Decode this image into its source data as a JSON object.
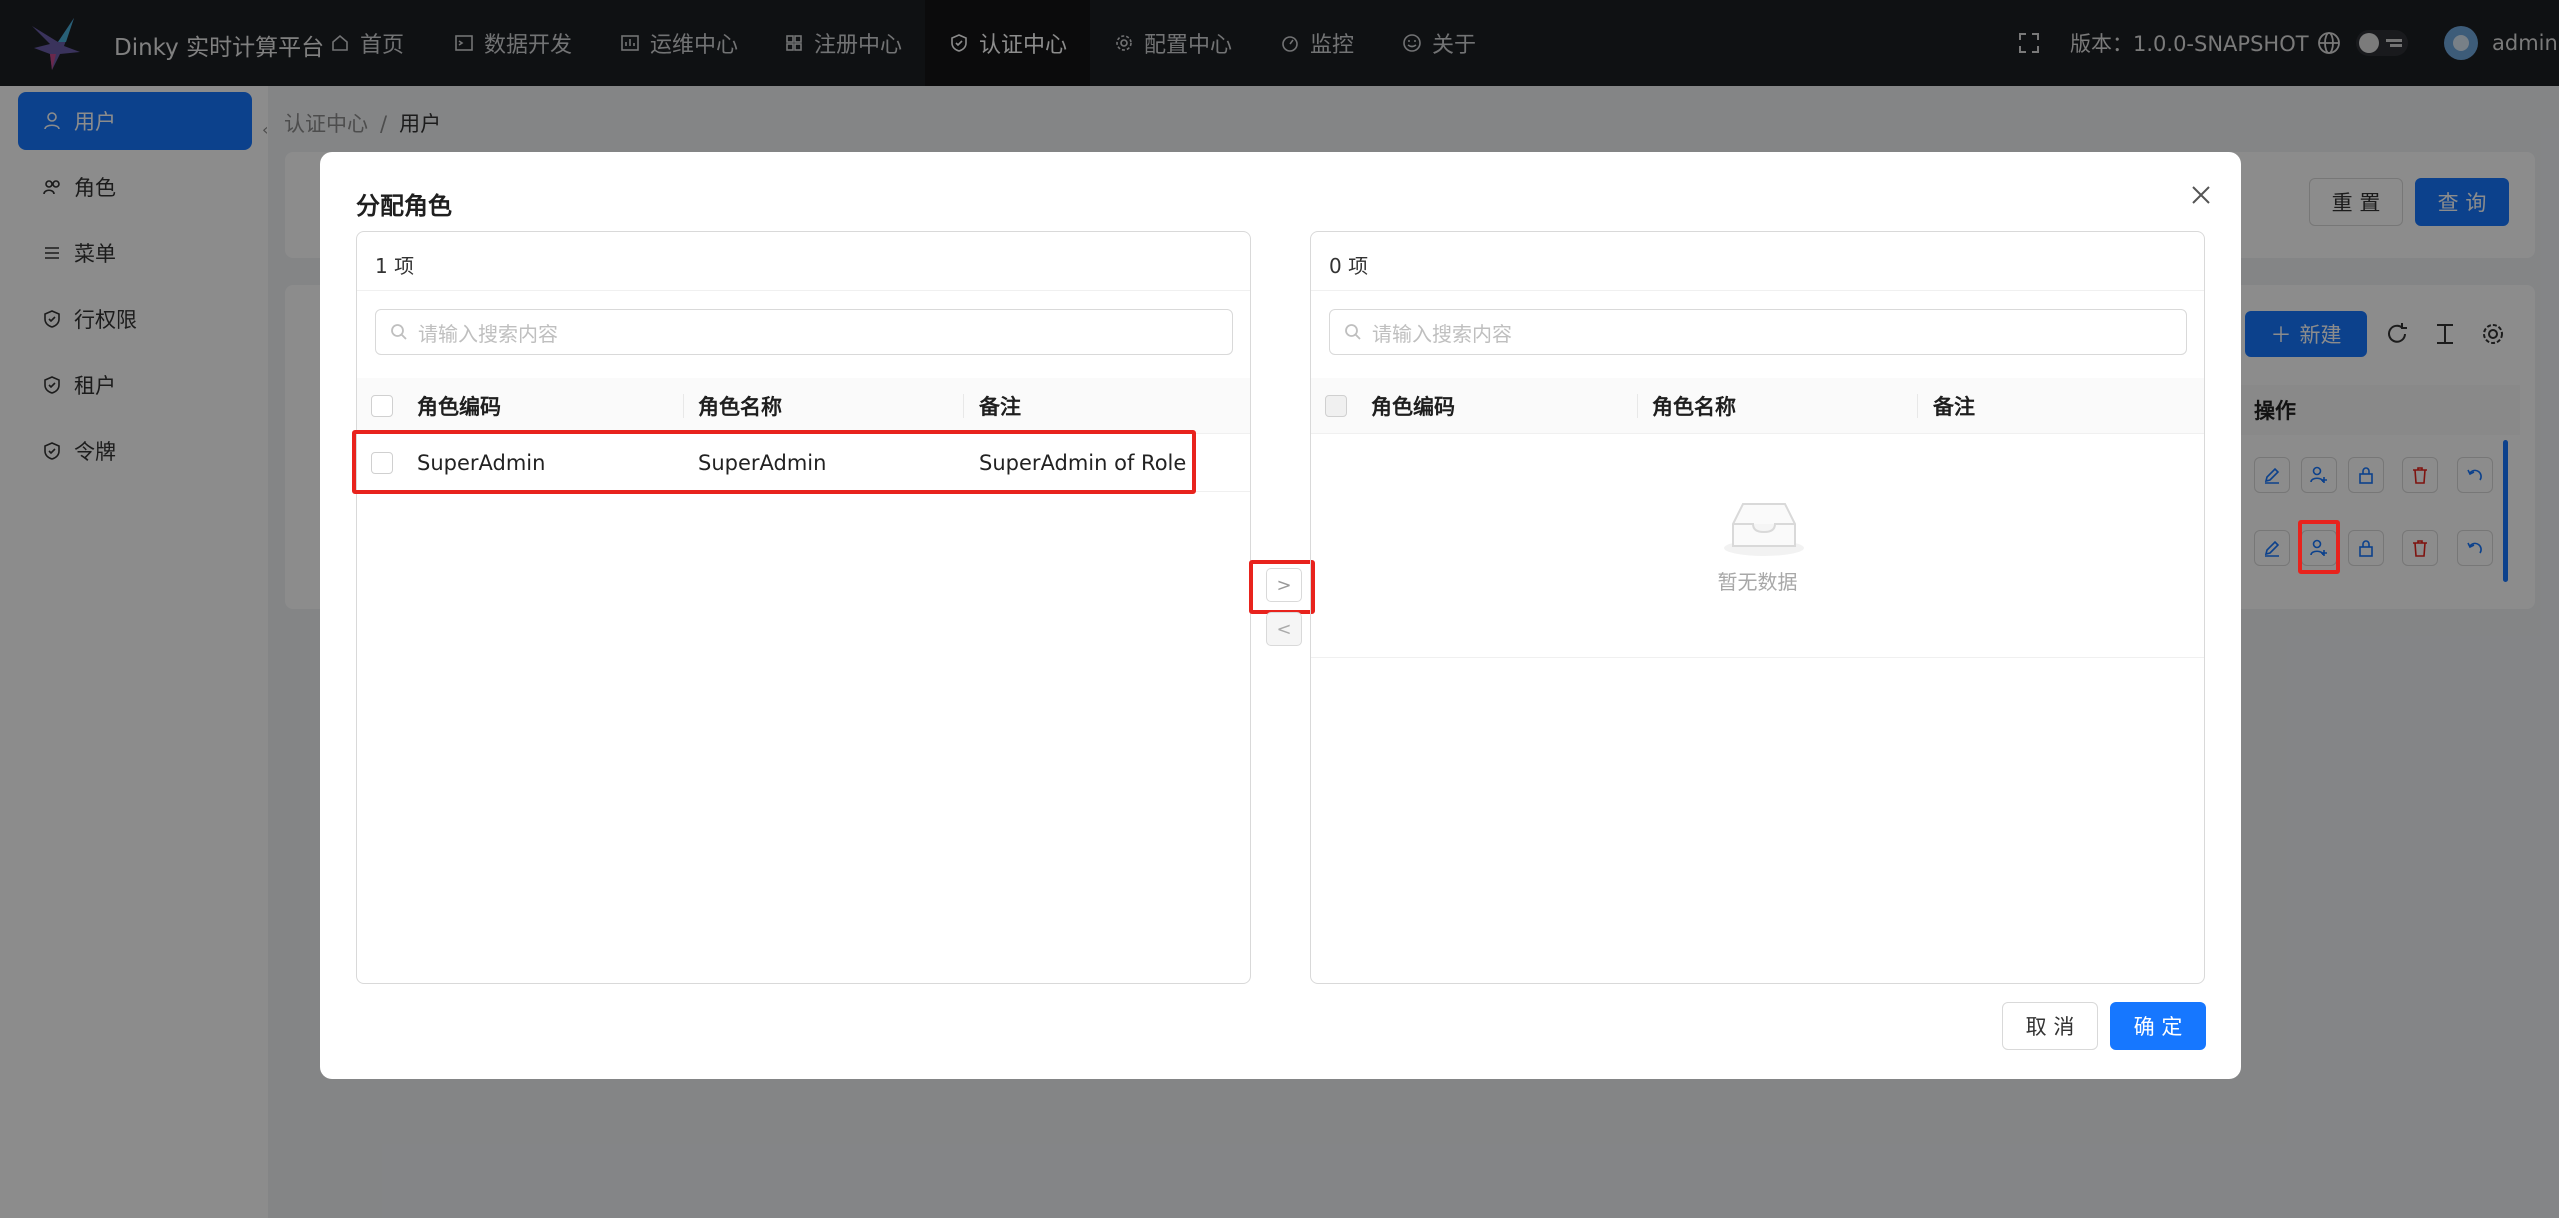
{
  "app": {
    "title": "Dinky 实时计算平台",
    "version_label": "版本：1.0.0-SNAPSHOT",
    "user": "admin"
  },
  "nav": [
    {
      "label": "首页",
      "icon": "home-icon"
    },
    {
      "label": "数据开发",
      "icon": "terminal-icon"
    },
    {
      "label": "运维中心",
      "icon": "chart-icon"
    },
    {
      "label": "注册中心",
      "icon": "grid-icon"
    },
    {
      "label": "认证中心",
      "icon": "shield-icon",
      "active": true
    },
    {
      "label": "配置中心",
      "icon": "gear-icon"
    },
    {
      "label": "监控",
      "icon": "dashboard-icon"
    },
    {
      "label": "关于",
      "icon": "smile-icon"
    }
  ],
  "sidebar": {
    "items": [
      {
        "label": "用户",
        "icon": "user-icon",
        "active": true
      },
      {
        "label": "角色",
        "icon": "team-icon"
      },
      {
        "label": "菜单",
        "icon": "menu-icon"
      },
      {
        "label": "行权限",
        "icon": "shield-icon"
      },
      {
        "label": "租户",
        "icon": "shield-icon"
      },
      {
        "label": "令牌",
        "icon": "shield-icon"
      }
    ]
  },
  "breadcrumb": {
    "parent": "认证中心",
    "sep": "/",
    "current": "用户"
  },
  "background": {
    "reset_label": "重 置",
    "query_label": "查 询",
    "new_label": "新建",
    "ops_header": "操作"
  },
  "modal": {
    "title": "分配角色",
    "left": {
      "count": "1 项",
      "search_placeholder": "请输入搜索内容",
      "columns": [
        "角色编码",
        "角色名称",
        "备注"
      ],
      "rows": [
        {
          "code": "SuperAdmin",
          "name": "SuperAdmin",
          "remark": "SuperAdmin of Role"
        }
      ]
    },
    "right": {
      "count": "0 项",
      "search_placeholder": "请输入搜索内容",
      "columns": [
        "角色编码",
        "角色名称",
        "备注"
      ],
      "empty_text": "暂无数据"
    },
    "to_right": ">",
    "to_left": "<",
    "cancel_label": "取 消",
    "ok_label": "确 定"
  },
  "colors": {
    "primary": "#1677ff",
    "highlight": "#e8231d",
    "topbar": "#1d1f23"
  }
}
